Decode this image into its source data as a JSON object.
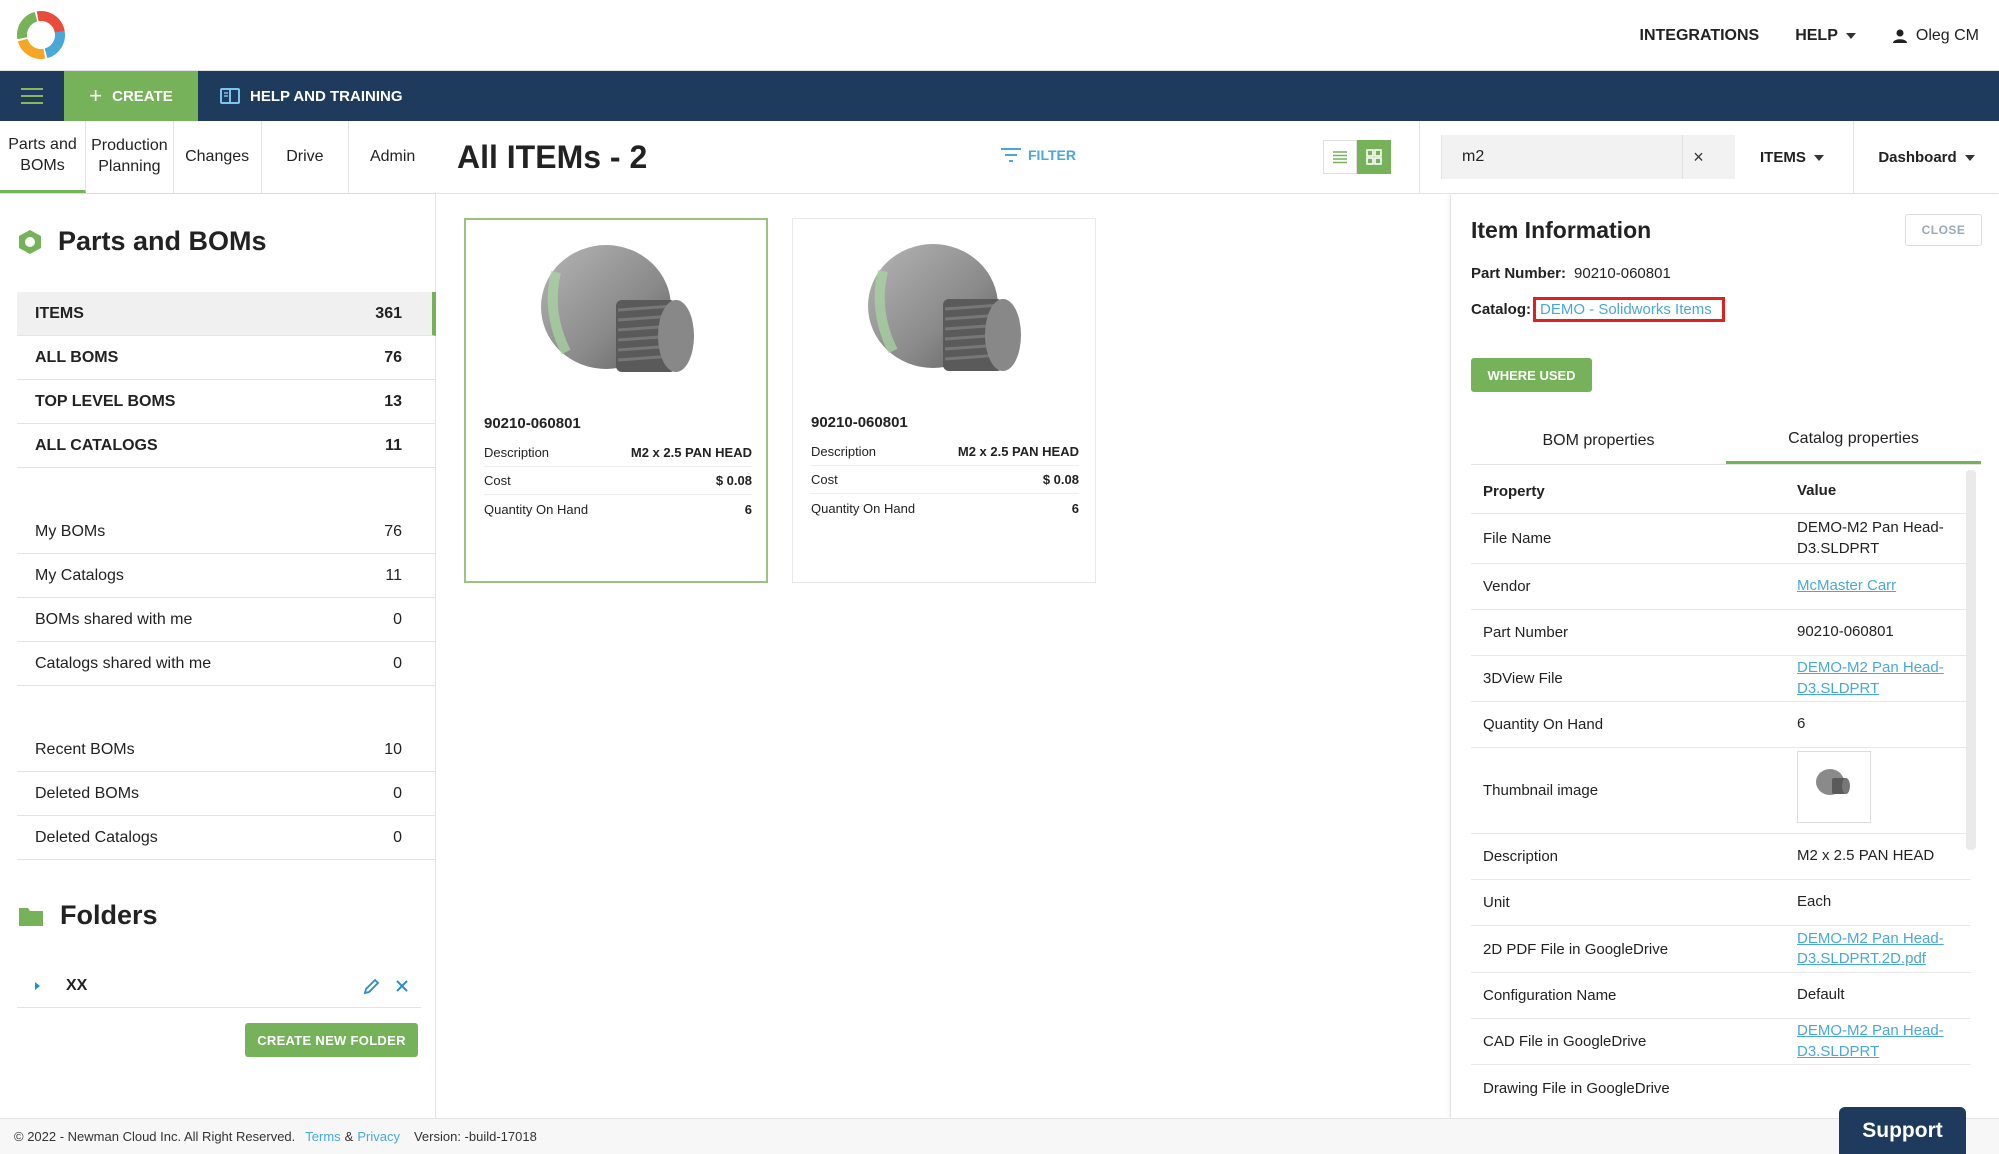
{
  "header": {
    "logo_alt": "Company logo",
    "nav": {
      "integrations": "INTEGRATIONS",
      "help": "HELP",
      "user": "Oleg CM"
    }
  },
  "toolbar": {
    "create_label": "CREATE",
    "help_training_label": "HELP AND TRAINING"
  },
  "module_tabs": [
    {
      "label": "Parts and BOMs"
    },
    {
      "label": "Production Planning"
    },
    {
      "label": "Changes"
    },
    {
      "label": "Drive"
    },
    {
      "label": "Admin"
    }
  ],
  "sidebar": {
    "title": "Parts and BOMs",
    "group1": [
      {
        "label": "ITEMS",
        "count": "361"
      },
      {
        "label": "ALL BOMS",
        "count": "76"
      },
      {
        "label": "TOP LEVEL BOMS",
        "count": "13"
      },
      {
        "label": "ALL CATALOGS",
        "count": "11"
      }
    ],
    "group2": [
      {
        "label": "My BOMs",
        "count": "76"
      },
      {
        "label": "My Catalogs",
        "count": "11"
      },
      {
        "label": "BOMs shared with me",
        "count": "0"
      },
      {
        "label": "Catalogs shared with me",
        "count": "0"
      }
    ],
    "group3": [
      {
        "label": "Recent BOMs",
        "count": "10"
      },
      {
        "label": "Deleted BOMs",
        "count": "0"
      },
      {
        "label": "Deleted Catalogs",
        "count": "0"
      }
    ],
    "folders_title": "Folders",
    "folder": {
      "name": "XX"
    },
    "create_folder_label": "CREATE NEW FOLDER"
  },
  "content": {
    "title": "All ITEMs - 2",
    "filter_label": "FILTER",
    "search_value": "m2",
    "items_dropdown": "ITEMS",
    "dashboard_dropdown": "Dashboard",
    "cards": [
      {
        "part_number": "90210-060801",
        "props": [
          {
            "k": "Description",
            "v": "M2 x 2.5 PAN HEAD"
          },
          {
            "k": "Cost",
            "v": "$ 0.08"
          },
          {
            "k": "Quantity On Hand",
            "v": "6"
          }
        ]
      },
      {
        "part_number": "90210-060801",
        "props": [
          {
            "k": "Description",
            "v": "M2 x 2.5 PAN HEAD"
          },
          {
            "k": "Cost",
            "v": "$ 0.08"
          },
          {
            "k": "Quantity On Hand",
            "v": "6"
          }
        ]
      }
    ]
  },
  "info_panel": {
    "title": "Item Information",
    "close_label": "CLOSE",
    "part_number_label": "Part Number:",
    "part_number": "90210-060801",
    "catalog_label": "Catalog:",
    "catalog": "DEMO - Solidworks Items",
    "where_used_label": "WHERE USED",
    "tabs": [
      {
        "label": "BOM properties"
      },
      {
        "label": "Catalog properties"
      }
    ],
    "table_header": {
      "property": "Property",
      "value": "Value"
    },
    "rows": [
      {
        "k": "File Name",
        "v": "DEMO-M2 Pan Head-D3.SLDPRT"
      },
      {
        "k": "Vendor",
        "v": "McMaster Carr"
      },
      {
        "k": "Part Number",
        "v": "90210-060801"
      },
      {
        "k": "3DView File",
        "v": "DEMO-M2 Pan Head-D3.SLDPRT"
      },
      {
        "k": "Quantity On Hand",
        "v": "6"
      },
      {
        "k": "Thumbnail image",
        "v": ""
      },
      {
        "k": "Description",
        "v": "M2 x 2.5 PAN HEAD"
      },
      {
        "k": "Unit",
        "v": "Each"
      },
      {
        "k": "2D PDF File in GoogleDrive",
        "v": "DEMO-M2 Pan Head-D3.SLDPRT.2D.pdf"
      },
      {
        "k": "Configuration Name",
        "v": "Default"
      },
      {
        "k": "CAD File in GoogleDrive",
        "v": "DEMO-M2 Pan Head-D3.SLDPRT"
      },
      {
        "k": "Drawing File in GoogleDrive",
        "v": ""
      }
    ]
  },
  "footer": {
    "copyright": "© 2022 - Newman Cloud Inc. All Right Reserved.",
    "terms": "Terms",
    "amp": "&",
    "privacy": "Privacy",
    "version": "Version: -build-17018"
  },
  "support_label": "Support",
  "colors": {
    "accent_green": "#76b25a",
    "navy": "#1e3a5c",
    "link_blue": "#4aa8d8",
    "highlight_red": "#e02020"
  }
}
